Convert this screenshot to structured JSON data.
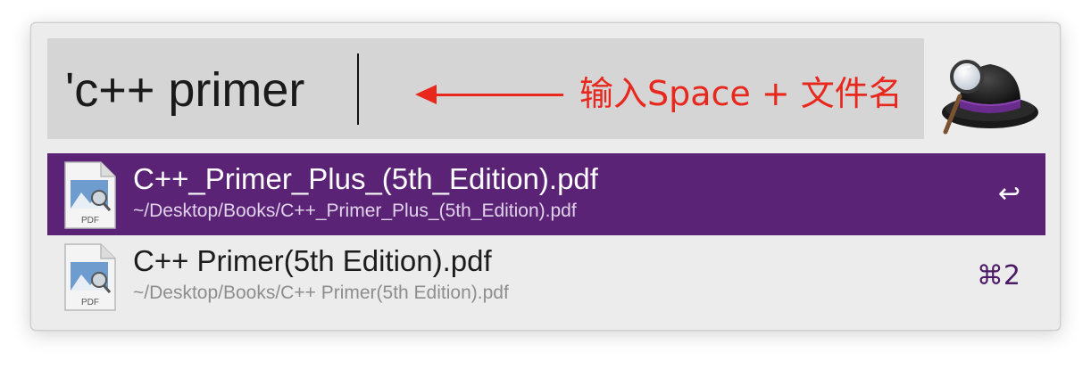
{
  "search": {
    "query": "'c++ primer",
    "annotation": "输入Space + 文件名"
  },
  "logo": {
    "icon": "alfred-hat-magnifier-icon"
  },
  "results": [
    {
      "title": "C++_Primer_Plus_(5th_Edition).pdf",
      "path": "~/Desktop/Books/C++_Primer_Plus_(5th_Edition).pdf",
      "shortcut": "↩",
      "icon_label": "PDF",
      "selected": true
    },
    {
      "title": "C++ Primer(5th Edition).pdf",
      "path": "~/Desktop/Books/C++ Primer(5th Edition).pdf",
      "shortcut": "⌘2",
      "icon_label": "PDF",
      "selected": false
    }
  ],
  "colors": {
    "selection": "#5b2376",
    "annotation": "#e8271d",
    "search_background": "#d5d5d5",
    "window_background": "#ececec"
  }
}
